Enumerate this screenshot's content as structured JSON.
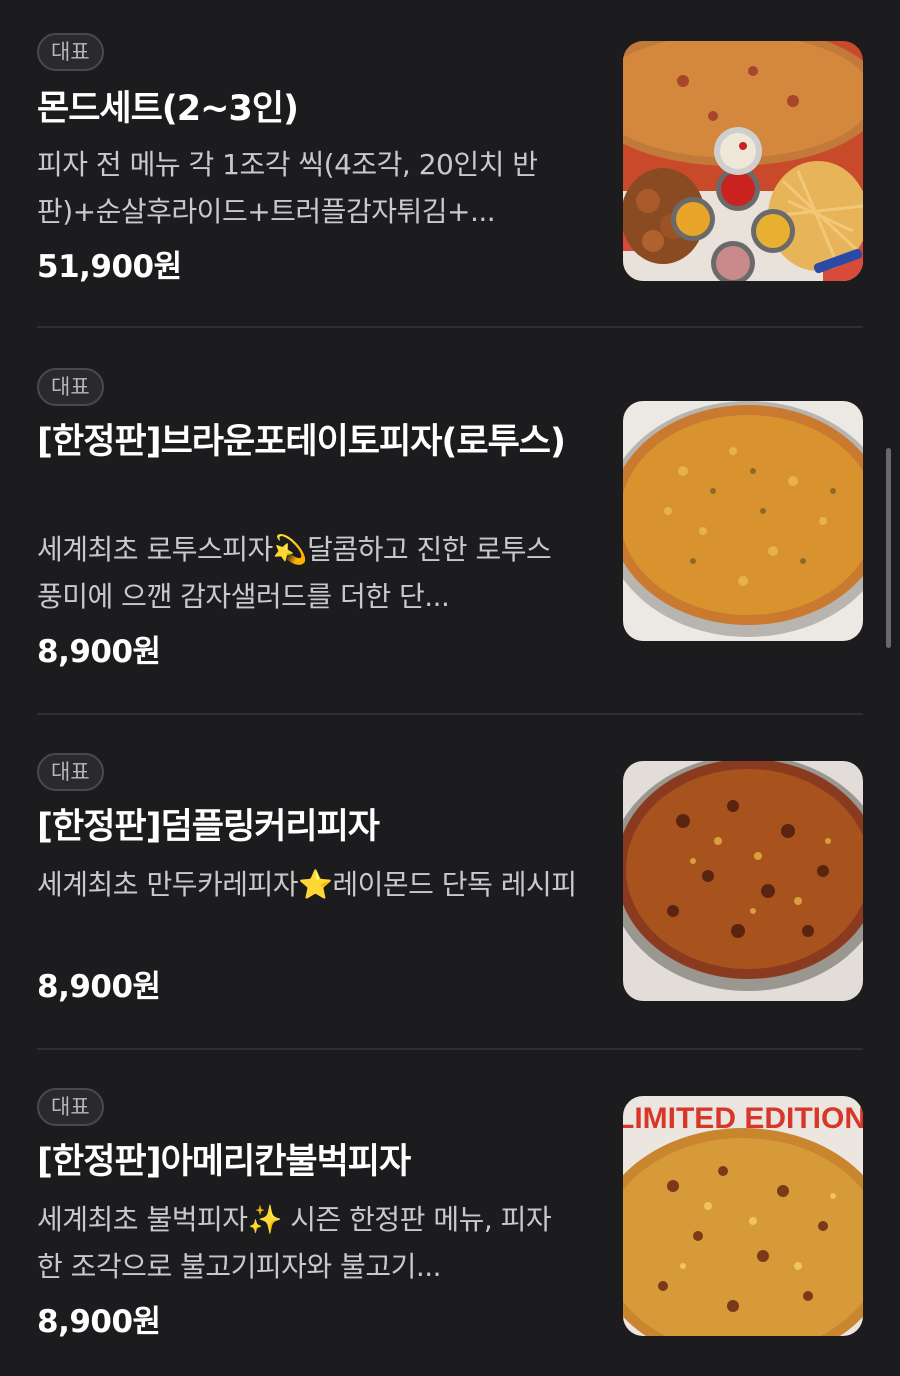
{
  "items": [
    {
      "badge": "대표",
      "name": "몬드세트(2~3인)",
      "description": "피자 전 메뉴 각 1조각 씩(4조각, 20인치 반판)+순살후라이드+트러플감자튀김+...",
      "price": "51,900원",
      "image_icon": "pizza-set-photo"
    },
    {
      "badge": "대표",
      "name": "[한정판]브라운포테이토피자(로투스)",
      "description": "세계최초 로투스피자💫달콤하고 진한 로투스 풍미에 으깬 감자샐러드를 더한 단...",
      "price": "8,900원",
      "image_icon": "potato-pizza-photo"
    },
    {
      "badge": "대표",
      "name": "[한정판]덤플링커리피자",
      "description": "세계최초 만두카레피자⭐레이몬드 단독 레시피",
      "price": "8,900원",
      "image_icon": "curry-pizza-photo"
    },
    {
      "badge": "대표",
      "name": "[한정판]아메리칸불벅피자",
      "description": "세계최초 불벅피자✨ 시즌 한정판 메뉴, 피자 한 조각으로 불고기피자와 불고기...",
      "price": "8,900원",
      "image_icon": "bulgogi-pizza-photo",
      "image_banner_text": "LIMITED EDITION"
    }
  ],
  "colors": {
    "background": "#1c1c1e",
    "text_primary": "#ffffff",
    "text_secondary": "#c9c9cc",
    "badge_border": "#4a4a4c",
    "divider": "#2f2f31"
  }
}
